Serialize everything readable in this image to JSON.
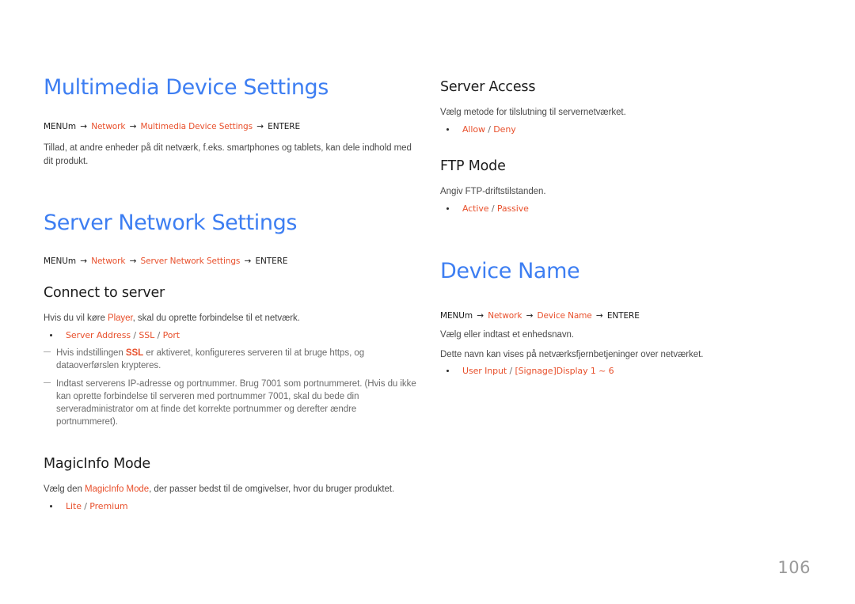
{
  "document": {
    "page_number": "106",
    "accent_color": "#e8502c",
    "heading_color": "#3d7ef2",
    "body_color": "#4a4a4a"
  },
  "left_column": {
    "multimedia": {
      "title": "Multimedia Device Settings",
      "path": {
        "menu_label": "MENU",
        "menu_key": "m",
        "arrow": "→",
        "node1": "Network",
        "node2": "Multimedia Device Settings",
        "enter_label": "ENTER",
        "enter_key": "E"
      },
      "description": "Tillad, at andre enheder på dit netværk, f.eks. smartphones og tablets, kan dele indhold med dit produkt."
    },
    "server_network": {
      "title": "Server Network Settings",
      "path": {
        "menu_label": "MENU",
        "menu_key": "m",
        "arrow": "→",
        "node1": "Network",
        "node2": "Server Network Settings",
        "enter_label": "ENTER",
        "enter_key": "E"
      },
      "connect": {
        "heading": "Connect to server",
        "desc_before": "Hvis du vil køre ",
        "desc_accent": "Player",
        "desc_after": ", skal du oprette forbindelse til et netværk.",
        "options": {
          "opt1": "Server Address",
          "sep1": " / ",
          "opt2": "SSL",
          "sep2": " / ",
          "opt3": "Port"
        },
        "notes": [
          {
            "before": "Hvis indstillingen ",
            "accent": "SSL",
            "after": " er aktiveret, konfigureres serveren til at bruge https, og dataoverførslen krypteres."
          },
          {
            "before": "",
            "accent": "",
            "after": "Indtast serverens IP-adresse og portnummer. Brug 7001 som portnummeret. (Hvis du ikke kan oprette forbindelse til serveren med portnummer 7001, skal du bede din serveradministrator om at finde det korrekte portnummer og derefter ændre portnummeret)."
          }
        ]
      },
      "magicinfo": {
        "heading": "MagicInfo Mode",
        "desc_before": "Vælg den ",
        "desc_accent": "MagicInfo Mode",
        "desc_after": ", der passer bedst til de omgivelser, hvor du bruger produktet.",
        "options": {
          "opt1": "Lite",
          "sep1": " / ",
          "opt2": "Premium"
        }
      }
    }
  },
  "right_column": {
    "server_access": {
      "heading": "Server Access",
      "description": "Vælg metode for tilslutning til servernetværket.",
      "options": {
        "opt1": "Allow",
        "sep1": " / ",
        "opt2": "Deny"
      }
    },
    "ftp_mode": {
      "heading": "FTP Mode",
      "description": "Angiv FTP-driftstilstanden.",
      "options": {
        "opt1": "Active",
        "sep1": " / ",
        "opt2": "Passive"
      }
    },
    "device_name": {
      "title": "Device Name",
      "path": {
        "menu_label": "MENU",
        "menu_key": "m",
        "arrow": "→",
        "node1": "Network",
        "node2": "Device Name",
        "enter_label": "ENTER",
        "enter_key": "E"
      },
      "description1": "Vælg eller indtast et enhedsnavn.",
      "description2": "Dette navn kan vises på netværksfjernbetjeninger over netværket.",
      "options": {
        "opt1": "User Input",
        "sep1": " / ",
        "opt2": "[Signage]Display  1 ~ 6"
      }
    }
  }
}
